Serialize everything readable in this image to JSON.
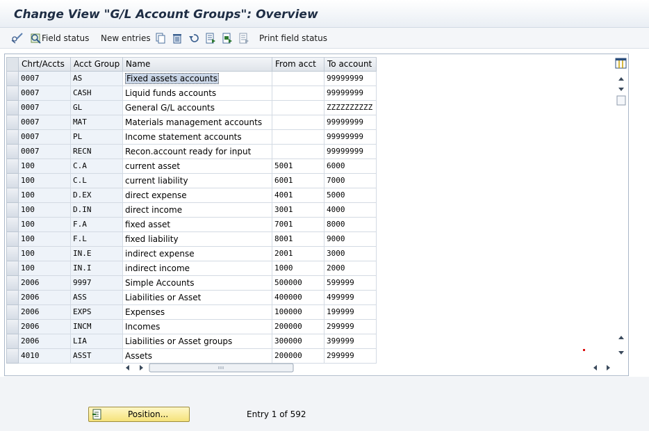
{
  "window": {
    "title": "Change View \"G/L Account Groups\": Overview"
  },
  "toolbar": {
    "field_status_label": "Field status",
    "new_entries_label": "New entries",
    "print_field_status_label": "Print field status"
  },
  "table": {
    "columns": [
      "Chrt/Accts",
      "Acct Group",
      "Name",
      "From acct",
      "To account"
    ],
    "rows": [
      [
        "0007",
        "AS",
        "Fixed assets accounts",
        "",
        "99999999"
      ],
      [
        "0007",
        "CASH",
        "Liquid funds accounts",
        "",
        "99999999"
      ],
      [
        "0007",
        "GL",
        "General G/L accounts",
        "",
        "ZZZZZZZZZZ"
      ],
      [
        "0007",
        "MAT",
        "Materials management accounts",
        "",
        "99999999"
      ],
      [
        "0007",
        "PL",
        "Income statement accounts",
        "",
        "99999999"
      ],
      [
        "0007",
        "RECN",
        "Recon.account ready for input",
        "",
        "99999999"
      ],
      [
        "100",
        "C.A",
        "current asset",
        "5001",
        "6000"
      ],
      [
        "100",
        "C.L",
        "current liability",
        "6001",
        "7000"
      ],
      [
        "100",
        "D.EX",
        "direct expense",
        "4001",
        "5000"
      ],
      [
        "100",
        "D.IN",
        "direct income",
        "3001",
        "4000"
      ],
      [
        "100",
        "F.A",
        "fixed asset",
        "7001",
        "8000"
      ],
      [
        "100",
        "F.L",
        "fixed liability",
        "8001",
        "9000"
      ],
      [
        "100",
        "IN.E",
        "indirect expense",
        "2001",
        "3000"
      ],
      [
        "100",
        "IN.I",
        "indirect income",
        "1000",
        "2000"
      ],
      [
        "2006",
        "9997",
        "Simple Accounts",
        "500000",
        "599999"
      ],
      [
        "2006",
        "ASS",
        "Liabilities or Asset",
        "400000",
        "499999"
      ],
      [
        "2006",
        "EXPS",
        "Expenses",
        "100000",
        "199999"
      ],
      [
        "2006",
        "INCM",
        "Incomes",
        "200000",
        "299999"
      ],
      [
        "2006",
        "LIA",
        "Liabilities or Asset groups",
        "300000",
        "399999"
      ],
      [
        "4010",
        "ASST",
        "Assets",
        "200000",
        "299999"
      ]
    ]
  },
  "footer": {
    "position_label": "Position...",
    "entry_text": "Entry 1 of 592"
  },
  "colors": {
    "accent": "#1e2d44",
    "key_column_bg": "#eef3f9",
    "position_button": "#f5e27a"
  }
}
